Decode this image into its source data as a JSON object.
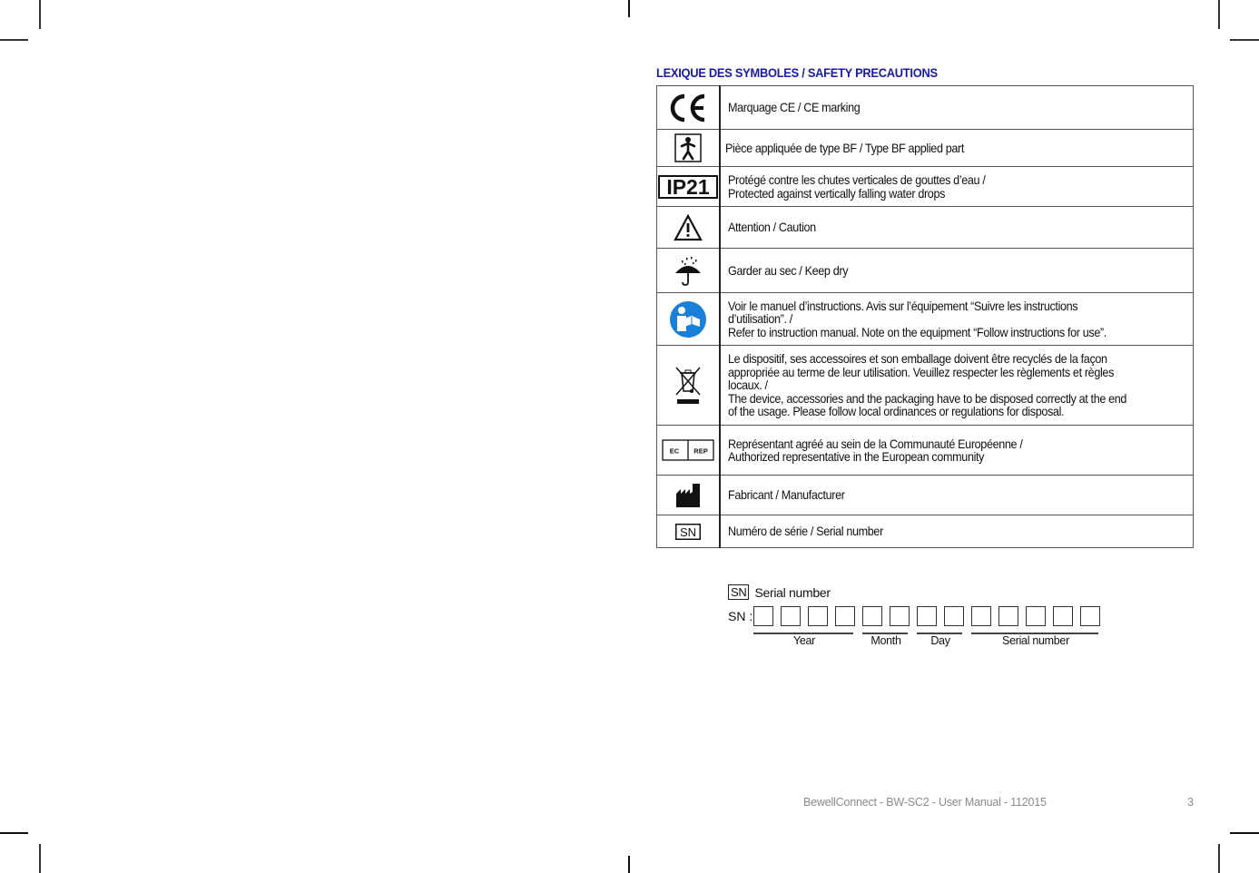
{
  "section": {
    "title": "LEXIQUE DES SYMBOLES / SAFETY PRECAUTIONS",
    "title_color": "#1a1aa8"
  },
  "symbols": [
    {
      "icon": "ce-marking-icon",
      "text": "Marquage CE / CE marking"
    },
    {
      "icon": "type-bf-applied-part-icon",
      "text": "Pièce appliquée de type BF / Type BF applied part"
    },
    {
      "icon": "ip21-icon",
      "icon_label": "IP21",
      "text": "Protégé contre les chutes verticales de gouttes d’eau /\nProtected against vertically falling water drops"
    },
    {
      "icon": "caution-warning-icon",
      "text": "Attention / Caution"
    },
    {
      "icon": "keep-dry-umbrella-icon",
      "text": "Garder au sec / Keep dry"
    },
    {
      "icon": "instruction-manual-icon",
      "icon_color": "#1a7fd6",
      "text": "Voir le manuel d’instructions.  Avis sur l’équipement “Suivre les instructions\nd’utilisation”. /\nRefer to instruction manual. Note on the equipment “Follow instructions for use”."
    },
    {
      "icon": "weee-crossed-bin-icon",
      "text": "Le dispositif, ses accessoires et son emballage doivent être recyclés de la façon\nappropriée au terme de leur utilisation.  Veuillez respecter les règlements et règles\nlocaux. /\nThe device, accessories and the packaging have to be disposed correctly at the end\nof the usage. Please follow local ordinances or regulations for disposal."
    },
    {
      "icon": "ec-rep-icon",
      "icon_label_left": "EC",
      "icon_label_right": "REP",
      "text": "Représentant agréé au sein de la Communauté Européenne /\nAuthorized representative in the European community"
    },
    {
      "icon": "manufacturer-factory-icon",
      "text": "Fabricant / Manufacturer"
    },
    {
      "icon": "serial-number-icon",
      "icon_label": "SN",
      "text": "Numéro de série / Serial number"
    }
  ],
  "serial": {
    "badge": "SN",
    "heading": "Serial number",
    "row_label": "SN :",
    "groups": [
      {
        "label": "Year",
        "boxes": 4
      },
      {
        "label": "Month",
        "boxes": 2
      },
      {
        "label": "Day",
        "boxes": 2
      },
      {
        "label": "Serial number",
        "boxes": 5
      }
    ]
  },
  "footer": {
    "text": "BewellConnect - BW-SC2 - User Manual - 112015",
    "page_number": "3"
  }
}
